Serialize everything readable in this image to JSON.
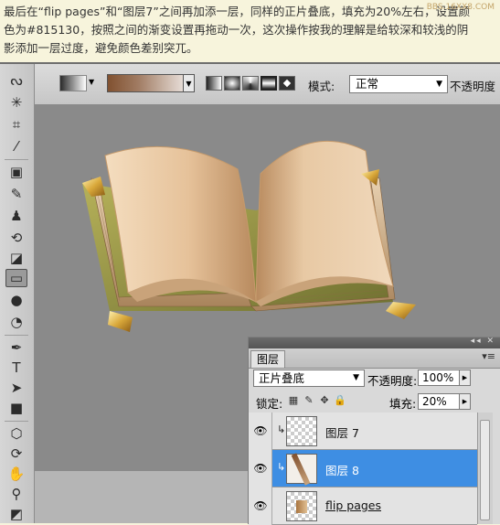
{
  "tutorial": {
    "line1": "最后在“flip pages”和“图层7”之间再加添一层，同样的正片叠底，填充为20%左右，设置颜",
    "line2": "色为#815130，按照之间的渐变设置再拖动一次，这次操作按我的理解是给较深和较浅的阴",
    "line3": "影添加一层过度，避免颜色差别突兀。",
    "watermark_url": "BBS.16XX8.COM"
  },
  "options_bar": {
    "mode_label": "模式:",
    "mode_value": "正常",
    "opacity_label": "不透明度",
    "gradient_color": "#815130"
  },
  "tools": [
    {
      "icon": "lasso-icon",
      "glyph": "ᔓ"
    },
    {
      "icon": "magic-wand-icon",
      "glyph": "✳"
    },
    {
      "icon": "crop-icon",
      "glyph": "⌗"
    },
    {
      "icon": "eyedropper-icon",
      "glyph": "⁄"
    },
    {
      "icon": "healing-brush-icon",
      "glyph": "▣"
    },
    {
      "icon": "brush-icon",
      "glyph": "✎"
    },
    {
      "icon": "clone-stamp-icon",
      "glyph": "♟"
    },
    {
      "icon": "history-brush-icon",
      "glyph": "⟲"
    },
    {
      "icon": "eraser-icon",
      "glyph": "◪"
    },
    {
      "icon": "gradient-icon",
      "glyph": "▭"
    },
    {
      "icon": "blur-icon",
      "glyph": "💧"
    },
    {
      "icon": "dodge-icon",
      "glyph": "◔"
    },
    {
      "icon": "pen-icon",
      "glyph": "✒"
    },
    {
      "icon": "type-icon",
      "glyph": "T"
    },
    {
      "icon": "path-select-icon",
      "glyph": "➤"
    },
    {
      "icon": "rectangle-icon",
      "glyph": "■"
    },
    {
      "icon": "3d-rotate-icon",
      "glyph": "⬡"
    },
    {
      "icon": "3d-orbit-icon",
      "glyph": "⟳"
    },
    {
      "icon": "hand-icon",
      "glyph": "✋"
    },
    {
      "icon": "zoom-icon",
      "glyph": "⚲"
    },
    {
      "icon": "color-swatch-icon",
      "glyph": "◩"
    }
  ],
  "layers_panel": {
    "tab_label": "图层",
    "blend_mode": "正片叠底",
    "opacity_label": "不透明度:",
    "opacity_value": "100%",
    "lock_label": "锁定:",
    "fill_label": "填充:",
    "fill_value": "20%",
    "layers": [
      {
        "name": "图层 7",
        "selected": false,
        "clipped": true
      },
      {
        "name": "图层 8",
        "selected": true,
        "clipped": true
      },
      {
        "name": "flip pages",
        "selected": false,
        "clipped": false
      }
    ]
  }
}
